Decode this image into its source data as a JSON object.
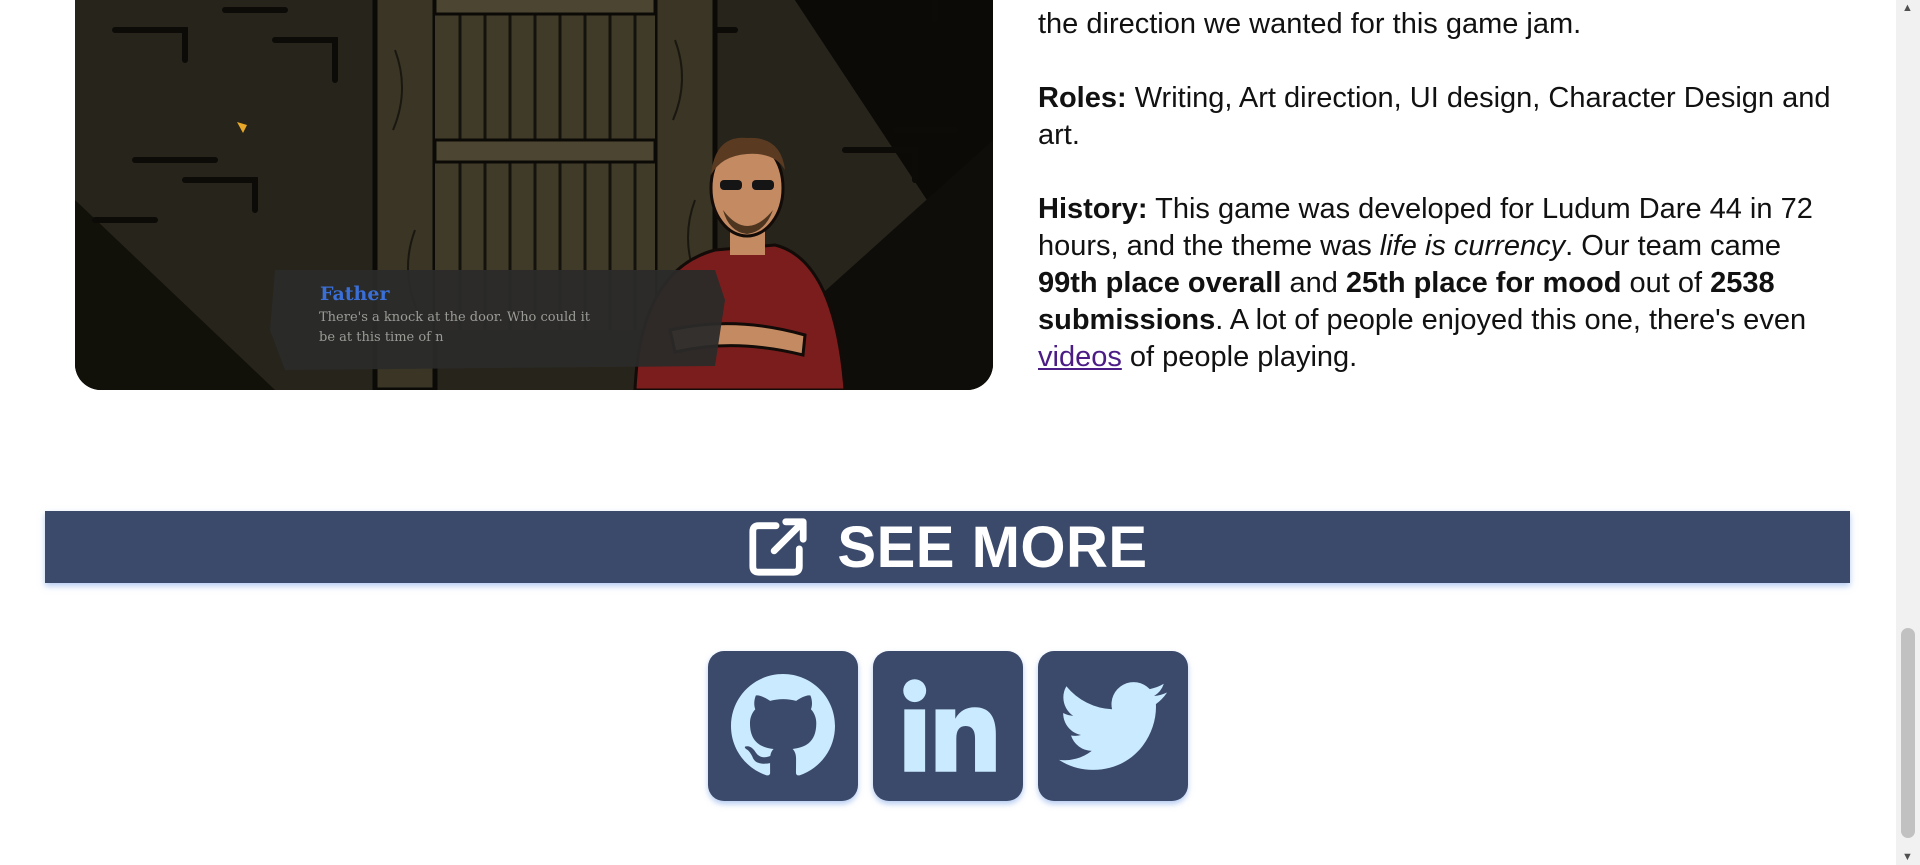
{
  "game_screenshot": {
    "speaker_name": "Father",
    "dialogue_line1": "There's a knock at the door. Who could it",
    "dialogue_line2": "be at this time of n"
  },
  "description": {
    "intro_tail": "the direction we wanted for this game jam.",
    "roles_label": "Roles:",
    "roles_text": " Writing, Art direction, UI design, Character Design and art.",
    "history_label": "History:",
    "history_text_1": " This game was developed for Ludum Dare 44 in 72 hours, and the theme was ",
    "history_theme": "life is currency",
    "history_text_2": ". Our team came ",
    "rank_overall": "99th place overall",
    "history_and": " and ",
    "rank_mood": "25th place for mood",
    "history_out_of": " out of ",
    "submissions": "2538 submissions",
    "history_text_3": ". A lot of people enjoyed this one, there's even ",
    "videos_link": "videos",
    "history_text_4": " of people playing."
  },
  "see_more": {
    "label": "SEE MORE",
    "icon": "external-link-icon"
  },
  "socials": [
    {
      "name": "GitHub",
      "icon": "github-icon"
    },
    {
      "name": "LinkedIn",
      "icon": "linkedin-icon"
    },
    {
      "name": "Twitter",
      "icon": "twitter-icon"
    }
  ],
  "colors": {
    "accent": "#3b4a6b",
    "icon_fill": "#c9eaff",
    "link": "#4b1c86",
    "shadow": "#78a0e6",
    "speaker_name": "#3a6fd8"
  }
}
